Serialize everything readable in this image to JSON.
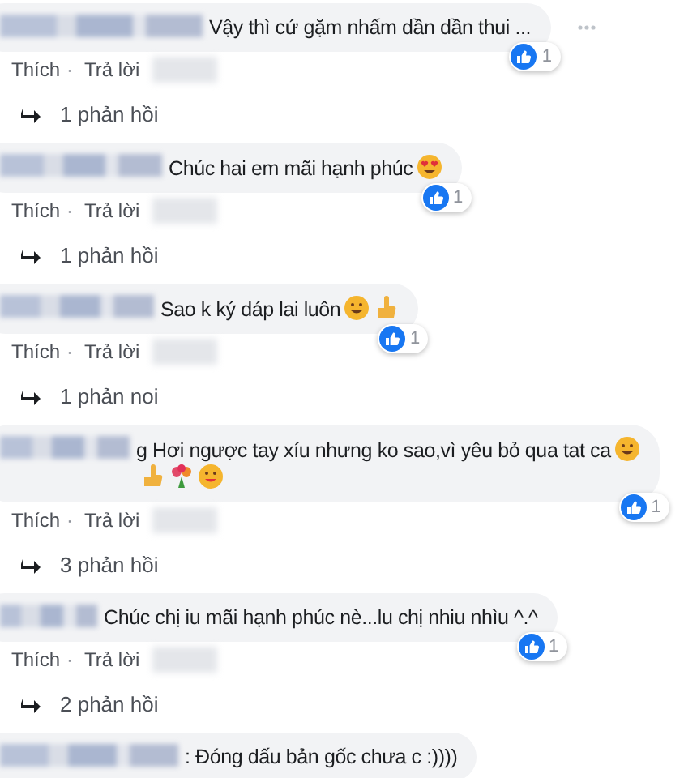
{
  "comments": [
    {
      "text": "Vậy thì cứ gặm nhấm dần dần thui ...",
      "likes": "1",
      "actions": [
        "Thích",
        "Trả lời"
      ],
      "separator": "·",
      "more": true,
      "replies": "1 phản hồi"
    },
    {
      "text": "Chúc hai em mãi hạnh phúc",
      "likes": "1",
      "actions": [
        "Thích",
        "Trả lời"
      ],
      "separator": "·",
      "more": false,
      "replies": "1 phản hồi"
    },
    {
      "text": "Sao k ký dáp lai luôn",
      "likes": "1",
      "actions": [
        "Thích",
        "Trả lời"
      ],
      "separator": "·",
      "more": false,
      "replies": "1 phản noi"
    },
    {
      "text": "g Hơi ngược tay xíu nhưng ko sao,vì yêu bỏ qua tat ca",
      "likes": "1",
      "actions": [
        "Thích",
        "Trả lời"
      ],
      "separator": "·",
      "more": false,
      "replies": "3 phản hồi"
    },
    {
      "text": "Chúc chị iu mãi hạnh phúc nè...lu chị nhiu nhìu ^.^",
      "likes": "1",
      "actions": [
        "Thích",
        "Trả lời"
      ],
      "separator": "·",
      "more": false,
      "replies": "2 phản hồi"
    },
    {
      "text": ": Đóng dấu bản gốc chưa c :))))",
      "more": false
    }
  ]
}
